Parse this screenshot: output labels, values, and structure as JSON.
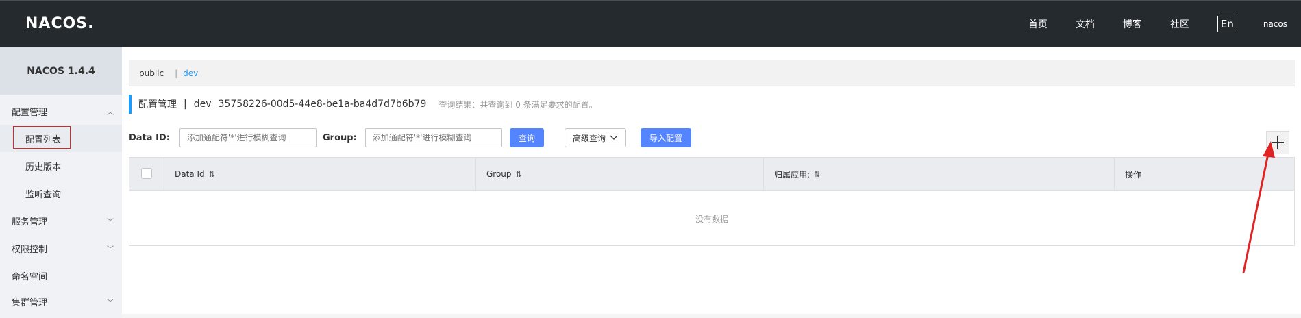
{
  "header": {
    "logo": "NACOS.",
    "nav": [
      "首页",
      "文档",
      "博客",
      "社区"
    ],
    "lang": "En",
    "user": "nacos"
  },
  "sidebar": {
    "version": "NACOS 1.4.4",
    "items": [
      {
        "label": "配置管理",
        "level": "top",
        "chevron": "up"
      },
      {
        "label": "配置列表",
        "level": "sub",
        "active": true
      },
      {
        "label": "历史版本",
        "level": "sub"
      },
      {
        "label": "监听查询",
        "level": "sub"
      },
      {
        "label": "服务管理",
        "level": "top",
        "chevron": "down"
      },
      {
        "label": "权限控制",
        "level": "top",
        "chevron": "down"
      },
      {
        "label": "命名空间",
        "level": "top"
      },
      {
        "label": "集群管理",
        "level": "top",
        "chevron": "down"
      }
    ]
  },
  "namespaces": {
    "items": [
      "public",
      "dev"
    ],
    "active": "dev"
  },
  "title": {
    "section": "配置管理",
    "namespace": "dev",
    "namespace_id": "35758226-00d5-44e8-be1a-ba4d7d7b6b79",
    "result_hint": "查询结果：共查询到 0 条满足要求的配置。"
  },
  "filters": {
    "data_id_label": "Data ID:",
    "data_id_placeholder": "添加通配符'*'进行模糊查询",
    "group_label": "Group:",
    "group_placeholder": "添加通配符'*'进行模糊查询",
    "search_button": "查询",
    "advanced_button": "高级查询",
    "import_button": "导入配置"
  },
  "table": {
    "columns": [
      "Data Id",
      "Group",
      "归属应用:",
      "操作"
    ],
    "empty_text": "没有数据"
  },
  "colors": {
    "header_bg": "#252a2f",
    "accent": "#209bfa",
    "primary_button": "#5584ff",
    "annotation_red": "#e02424"
  }
}
